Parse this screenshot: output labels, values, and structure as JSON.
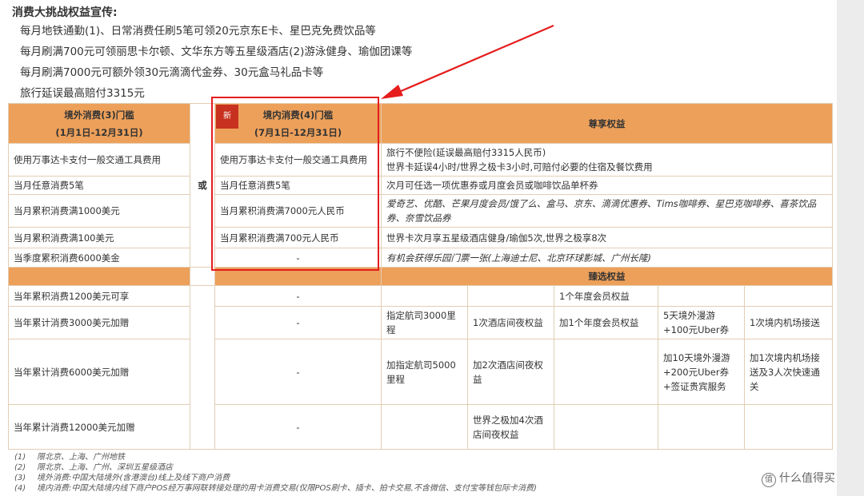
{
  "intro": {
    "title": "消费大挑战权益宣传:",
    "lines": [
      "每月地铁通勤(1)、日常消费任刷5笔可领20元京东E卡、星巴克免费饮品等",
      "每月刷满700元可领丽思卡尔顿、文华东方等五星级酒店(2)游泳健身、瑜伽团课等",
      "每月刷满7000元可额外领30元滴滴代金券、30元盒马礼品卡等",
      "旅行延误最高赔付3315元"
    ]
  },
  "table": {
    "overseas_header": "境外消费(3)门槛",
    "overseas_period": "(1月1日-12月31日)",
    "or_label": "或",
    "domestic_header": "境内消费(4)门槛",
    "domestic_period": "(7月1日-12月31日)",
    "new_badge": "新",
    "benefit_header": "尊享权益",
    "rows": [
      {
        "overseas": "使用万事达卡支付一般交通工具费用",
        "domestic": "使用万事达卡支付一般交通工具费用",
        "benefit": "旅行不便险(延误最高赔付3315人民币)\n世界卡延误4小时/世界之极卡3小时,可赔付必要的住宿及餐饮费用"
      },
      {
        "overseas": "当月任意消费5笔",
        "domestic": "当月任意消费5笔",
        "benefit": "次月可任选一项优惠券或月度会员或咖啡饮品单杯券"
      },
      {
        "overseas": "当月累积消费满1000美元",
        "domestic": "当月累积消费满7000元人民币",
        "benefit": "爱奇艺、优酷、芒果月度会员/饿了么、盒马、京东、滴滴优惠券、Tims咖啡券、星巴克咖啡券、喜茶饮品券、奈雪饮品券"
      },
      {
        "overseas": "当月累积消费满100美元",
        "domestic": "当月累积消费满700元人民币",
        "benefit": "世界卡次月享五星级酒店健身/瑜伽5次,世界之极享8次"
      },
      {
        "overseas": "当季度累积消费6000美金",
        "domestic": "-",
        "benefit": "有机会获得乐园门票一张(上海迪士尼、北京环球影城、广州长隆)"
      }
    ],
    "select_header": "臻选权益",
    "select_rows": [
      {
        "overseas": "当年累积消费1200美元可享",
        "domestic": "-",
        "cells": [
          "",
          "",
          "1个年度会员权益",
          "",
          ""
        ]
      },
      {
        "overseas": "当年累计消费3000美元加赠",
        "domestic": "-",
        "cells": [
          "指定航司3000里程",
          "1次酒店间夜权益",
          "加1个年度会员权益",
          "5天境外漫游+100元Uber券",
          "1次境内机场接送"
        ]
      },
      {
        "overseas": "当年累计消费6000美元加赠",
        "domestic": "-",
        "cells": [
          "加指定航司5000里程",
          "加2次酒店间夜权益",
          "",
          "加10天境外漫游+200元Uber券+签证贵宾服务",
          "加1次境内机场接送及3人次快速通关"
        ]
      },
      {
        "overseas": "当年累计消费12000美元加赠",
        "domestic": "-",
        "cells": [
          "",
          "世界之极加4次酒店间夜权益",
          "",
          "",
          ""
        ]
      }
    ]
  },
  "notes": [
    {
      "n": "(1)",
      "text": "限北京、上海、广州地铁"
    },
    {
      "n": "(2)",
      "text": "限北京、上海、广州、深圳五星级酒店"
    },
    {
      "n": "(3)",
      "text": "境外消费:中国大陆境外(含港澳台)线上及线下商户消费"
    },
    {
      "n": "(4)",
      "text": "境内消费:中国大陆境内线下商户POS经万事网联转接处理的用卡消费交易(仅限POS刷卡、插卡、拍卡交易,不含微信、支付宝等钱包际卡消费)"
    }
  ],
  "watermark": {
    "icon": "值",
    "text": "什么值得买"
  },
  "colors": {
    "header": "#eda05a",
    "highlight": "#e51d1d",
    "badge": "#c8311f"
  }
}
